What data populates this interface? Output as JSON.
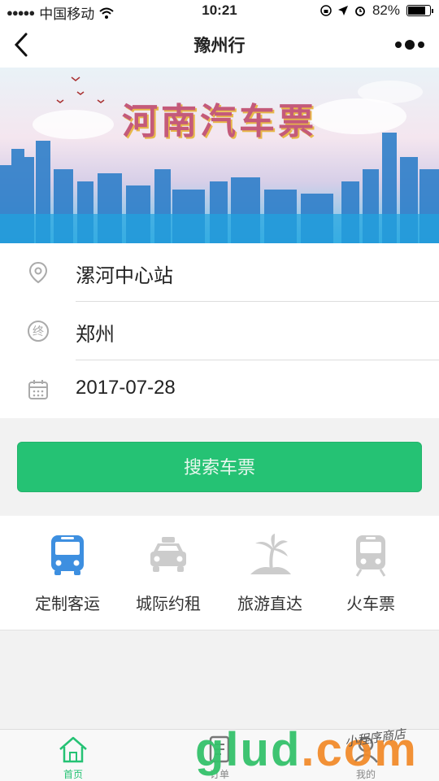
{
  "status_bar": {
    "carrier": "中国移动",
    "time": "10:21",
    "battery": "82%",
    "battery_level": 0.82
  },
  "navbar": {
    "title": "豫州行",
    "back_icon": "chevron-left-icon",
    "more_icon": "more-dots-icon"
  },
  "banner": {
    "title": "河南汽车票"
  },
  "form": {
    "origin": "漯河中心站",
    "destination": "郑州",
    "destination_icon_char": "终",
    "date": "2017-07-28"
  },
  "search_button": {
    "label": "搜索车票"
  },
  "services": [
    {
      "label": "定制客运",
      "icon": "bus-icon",
      "color": "#3d8fe0"
    },
    {
      "label": "城际约租",
      "icon": "taxi-icon",
      "color": "#cccccc"
    },
    {
      "label": "旅游直达",
      "icon": "palm-island-icon",
      "color": "#cccccc"
    },
    {
      "label": "火车票",
      "icon": "train-icon",
      "color": "#cccccc"
    }
  ],
  "tabbar": {
    "tabs": [
      {
        "label": "首页",
        "icon": "home-icon",
        "active": true
      },
      {
        "label": "订单",
        "icon": "order-icon",
        "active": false
      },
      {
        "label": "我的",
        "icon": "profile-icon",
        "active": false
      }
    ]
  },
  "watermark": {
    "logo": "glud",
    "suffix": ".com",
    "tagline": "小程序商店"
  },
  "colors": {
    "accent": "#25c274",
    "primary_blue": "#3d8fe0",
    "inactive": "#cccccc"
  }
}
